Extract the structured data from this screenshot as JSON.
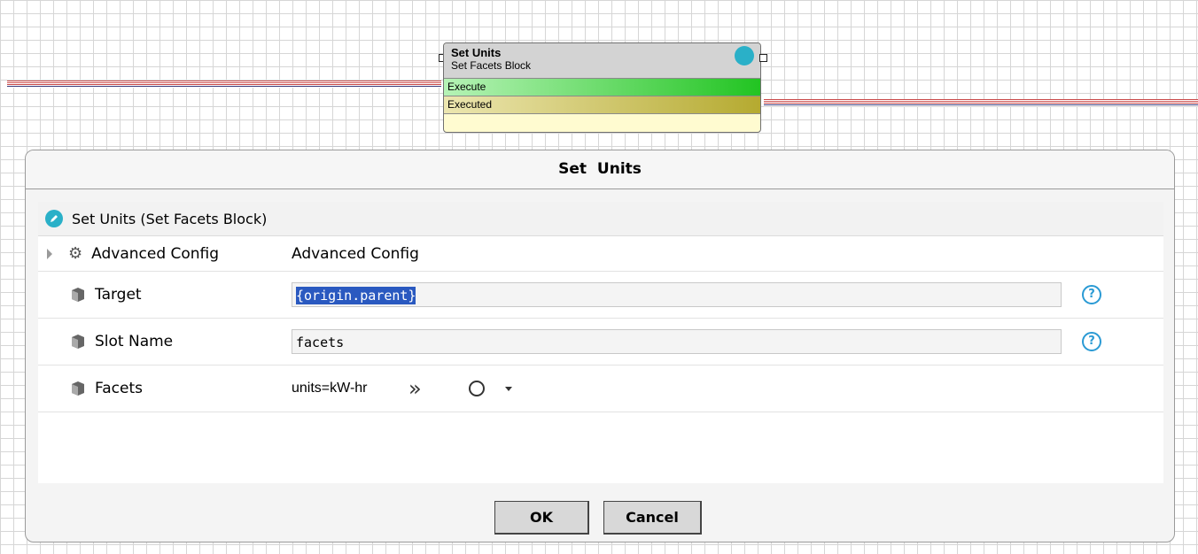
{
  "node": {
    "title": "Set Units",
    "subtitle": "Set Facets Block",
    "slots": [
      "Execute",
      "Executed"
    ]
  },
  "dialog": {
    "title": "Set  Units",
    "header": "Set Units  (Set Facets Block)",
    "rows": [
      {
        "label": "Advanced Config",
        "value": "Advanced Config"
      },
      {
        "label": "Target",
        "value": "{origin.parent}"
      },
      {
        "label": "Slot Name",
        "value": "facets"
      },
      {
        "label": "Facets",
        "value": "units=kW-hr"
      }
    ],
    "ok_label": "OK",
    "cancel_label": "Cancel",
    "help_glyph": "?"
  },
  "colors": {
    "accent": "#2ab0c8",
    "execute": "#22c422",
    "executed": "#b5aa30",
    "selection": "#2a59c0"
  }
}
